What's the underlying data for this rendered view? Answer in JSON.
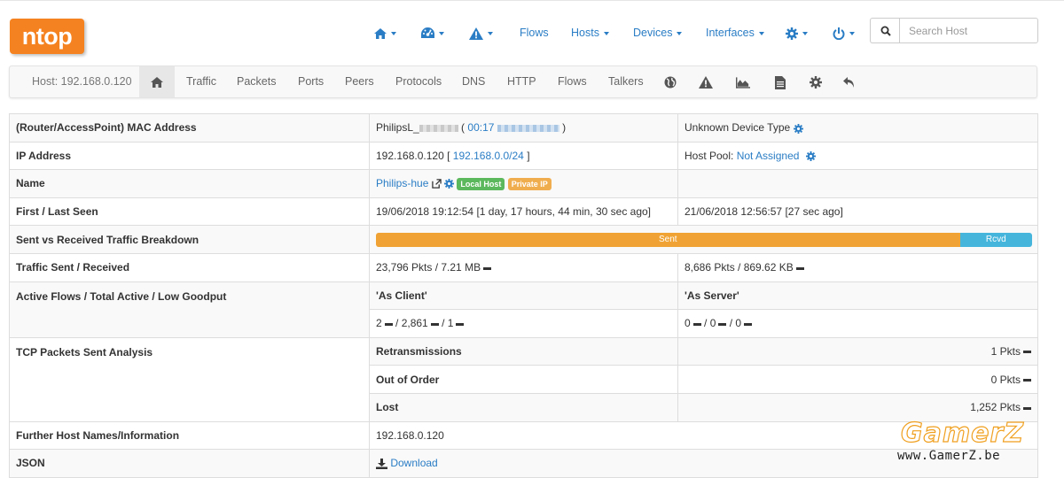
{
  "app": {
    "logo_text": "ntop"
  },
  "nav": {
    "home_icon": "home-icon",
    "dashboard_icon": "dashboard-icon",
    "alert_icon": "warning-icon",
    "flows": "Flows",
    "hosts": "Hosts",
    "devices": "Devices",
    "interfaces": "Interfaces",
    "settings_icon": "gear-icon",
    "power_icon": "power-icon"
  },
  "search": {
    "placeholder": "Search Host"
  },
  "subnav": {
    "host_label": "Host: 192.168.0.120",
    "tabs": [
      "Traffic",
      "Packets",
      "Ports",
      "Peers",
      "Protocols",
      "DNS",
      "HTTP",
      "Flows",
      "Talkers"
    ]
  },
  "table": {
    "mac": {
      "label": "(Router/AccessPoint) MAC Address",
      "name_prefix": "PhilipsL_",
      "open": "(",
      "mac_prefix": "00:17",
      "close": ")",
      "device_type": "Unknown Device Type"
    },
    "ip": {
      "label": "IP Address",
      "value": "192.168.0.120",
      "bracket_open": "[",
      "network": "192.168.0.0/24",
      "bracket_close": "]",
      "pool_label": "Host Pool:",
      "pool_value": "Not Assigned"
    },
    "name": {
      "label": "Name",
      "value": "Philips-hue",
      "badge_local": "Local Host",
      "badge_private": "Private IP"
    },
    "seen": {
      "label": "First / Last Seen",
      "first": "19/06/2018 19:12:54 [1 day, 17 hours, 44 min, 30 sec ago]",
      "last": "21/06/2018 12:56:57 [27 sec ago]"
    },
    "breakdown": {
      "label": "Sent vs Received Traffic Breakdown",
      "sent_label": "Sent",
      "rcvd_label": "Rcvd",
      "sent_fraction": 0.89
    },
    "traffic": {
      "label": "Traffic Sent / Received",
      "sent": "23,796 Pkts / 7.21 MB",
      "received": "8,686 Pkts / 869.62 KB"
    },
    "flows": {
      "label": "Active Flows / Total Active / Low Goodput",
      "client_header": "'As Client'",
      "server_header": "'As Server'",
      "client_a": "2",
      "client_b": "/ 2,861",
      "client_c": "/ 1",
      "server_a": "0",
      "server_b": "/ 0",
      "server_c": "/ 0"
    },
    "tcp": {
      "label": "TCP Packets Sent Analysis",
      "retrans_label": "Retransmissions",
      "retrans_value": "1 Pkts",
      "ooo_label": "Out of Order",
      "ooo_value": "0 Pkts",
      "lost_label": "Lost",
      "lost_value": "1,252 Pkts"
    },
    "further": {
      "label": "Further Host Names/Information",
      "value": "192.168.0.120"
    },
    "json": {
      "label": "JSON",
      "download": "Download"
    }
  },
  "watermark": {
    "big": "GamerZ",
    "small": "www.GamerZ.be"
  },
  "colors": {
    "accent": "#2a7dc5",
    "logo": "#f58220",
    "sent": "#f0a334",
    "rcvd": "#45b5dc",
    "badge_green": "#5cb85c",
    "badge_orange": "#f0ad4e"
  }
}
